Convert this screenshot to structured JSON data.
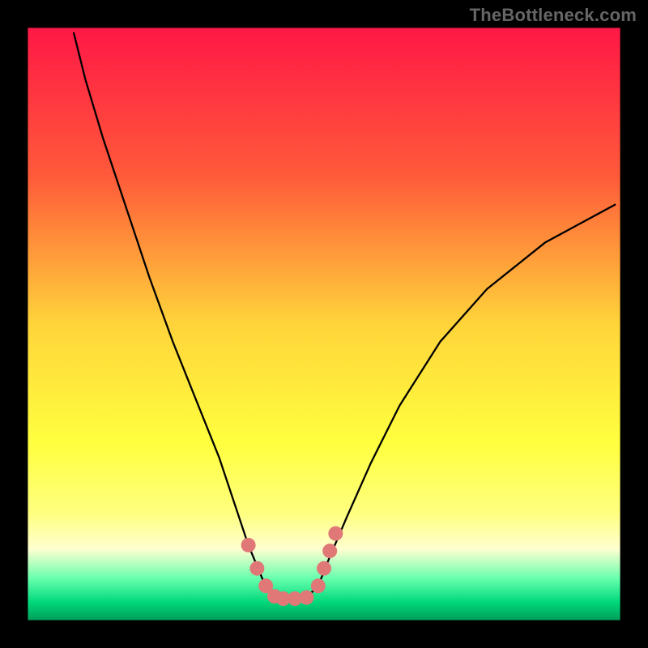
{
  "watermark": "TheBottleneck.com",
  "chart_data": {
    "type": "line",
    "title": "",
    "xlabel": "",
    "ylabel": "",
    "xlim": [
      0,
      100
    ],
    "ylim": [
      0,
      100
    ],
    "grid": false,
    "legend": false,
    "background_gradient": {
      "stops": [
        {
          "pos": 0.0,
          "color": "#ff1846"
        },
        {
          "pos": 0.25,
          "color": "#ff5a3a"
        },
        {
          "pos": 0.5,
          "color": "#ffd43a"
        },
        {
          "pos": 0.7,
          "color": "#ffff3e"
        },
        {
          "pos": 0.82,
          "color": "#ffff80"
        },
        {
          "pos": 0.88,
          "color": "#ffffd0"
        },
        {
          "pos": 0.93,
          "color": "#66ffad"
        },
        {
          "pos": 0.97,
          "color": "#00d87a"
        },
        {
          "pos": 1.0,
          "color": "#009e5a"
        }
      ]
    },
    "outer_border_inset": 4.3,
    "series": [
      {
        "name": "bottleneck-curve",
        "color": "#000000",
        "x": [
          7.0,
          9.0,
          12.0,
          16.0,
          20.0,
          24.0,
          28.0,
          32.0,
          35.0,
          37.0,
          39.5,
          41.5,
          43.0,
          45.0,
          47.0,
          49.0,
          51.0,
          54.0,
          58.0,
          63.0,
          70.0,
          78.0,
          88.0,
          100.0
        ],
        "values": [
          100.0,
          92.0,
          82.0,
          70.0,
          58.0,
          47.0,
          37.0,
          27.0,
          18.0,
          12.0,
          6.0,
          3.0,
          2.8,
          2.8,
          3.0,
          5.0,
          10.0,
          17.0,
          26.0,
          36.0,
          47.0,
          56.0,
          64.0,
          70.5
        ]
      }
    ],
    "markers": {
      "name": "highlight-band",
      "color": "#e07878",
      "radius_px": 9,
      "points": [
        {
          "x": 37.0,
          "y": 12.0
        },
        {
          "x": 38.5,
          "y": 8.0
        },
        {
          "x": 40.0,
          "y": 5.0
        },
        {
          "x": 41.5,
          "y": 3.2
        },
        {
          "x": 43.0,
          "y": 2.8
        },
        {
          "x": 45.0,
          "y": 2.8
        },
        {
          "x": 47.0,
          "y": 3.0
        },
        {
          "x": 49.0,
          "y": 5.0
        },
        {
          "x": 50.0,
          "y": 8.0
        },
        {
          "x": 51.0,
          "y": 11.0
        },
        {
          "x": 52.0,
          "y": 14.0
        }
      ]
    }
  }
}
